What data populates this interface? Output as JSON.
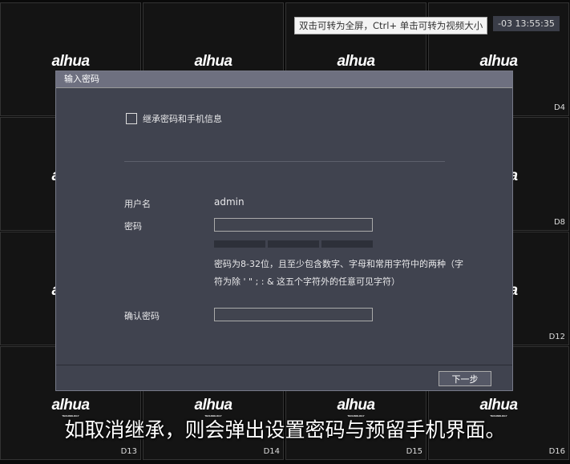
{
  "tooltip": "双击可转为全屏，Ctrl+ 单击可转为视频大小",
  "clock": "-03 13:55:35",
  "logo": "alhua",
  "logo_sub": "TECHNOLOGY",
  "channels": [
    "D4",
    "D8",
    "D12",
    "D13",
    "D14",
    "D15",
    "D16"
  ],
  "dialog": {
    "title": "输入密码",
    "inherit_label": "继承密码和手机信息",
    "username_label": "用户名",
    "username_value": "admin",
    "password_label": "密码",
    "password_value": "",
    "hint_line1": "密码为8-32位，且至少包含数字、字母和常用字符中的两种（字",
    "hint_line2": "符为除 ' \" ; : & 这五个字符外的任意可见字符）",
    "confirm_label": "确认密码",
    "confirm_value": "",
    "next_button": "下一步"
  },
  "subtitle": "如取消继承，则会弹出设置密码与预留手机界面。"
}
